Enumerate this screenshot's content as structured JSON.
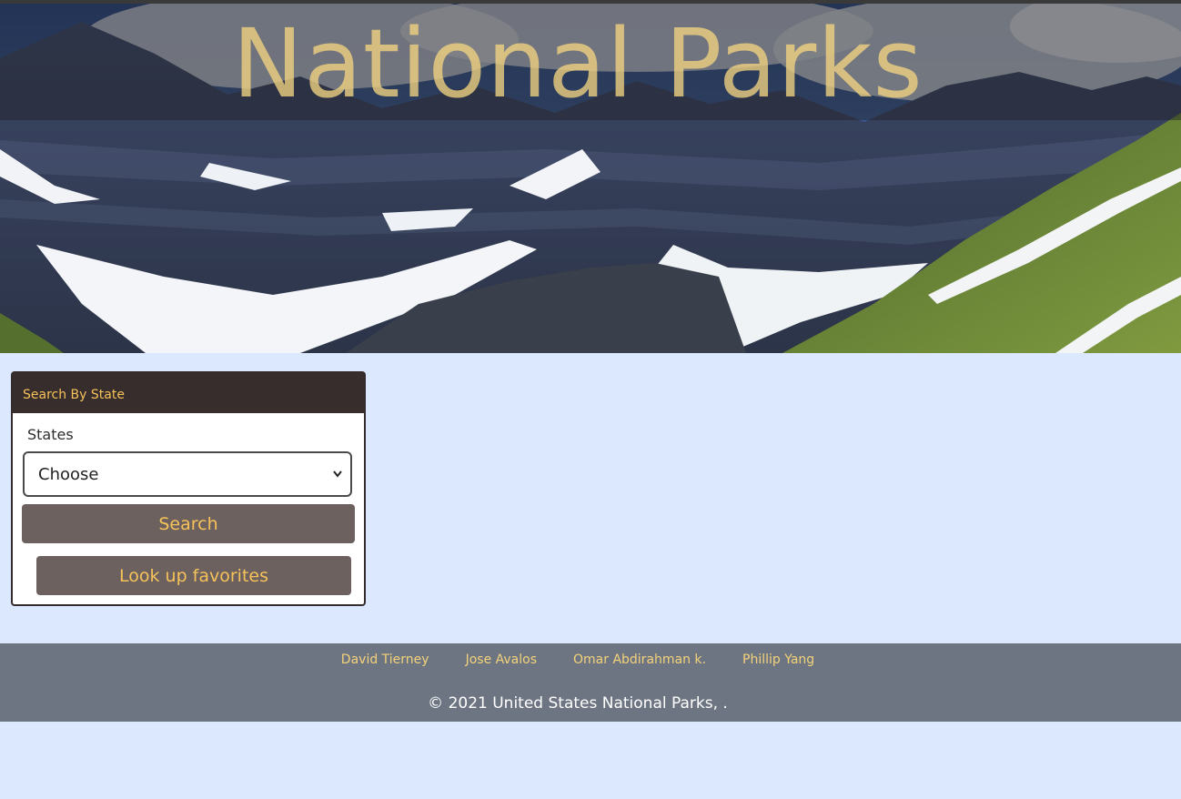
{
  "header": {
    "title": "National Parks"
  },
  "search_card": {
    "heading": "Search By State",
    "states_label": "States",
    "select_value": "Choose",
    "search_button": "Search",
    "favorites_button": "Look up favorites"
  },
  "footer": {
    "links": [
      "David Tierney",
      "Jose Avalos",
      "Omar Abdirahman k.",
      "Phillip Yang"
    ],
    "copyright": "© 2021 United States National Parks, ."
  },
  "colors": {
    "page_background": "#dbe8fd",
    "accent_text": "#f6c25a",
    "card_header": "#372d2d",
    "button": "#6c615f",
    "footer": "#6e7582"
  }
}
